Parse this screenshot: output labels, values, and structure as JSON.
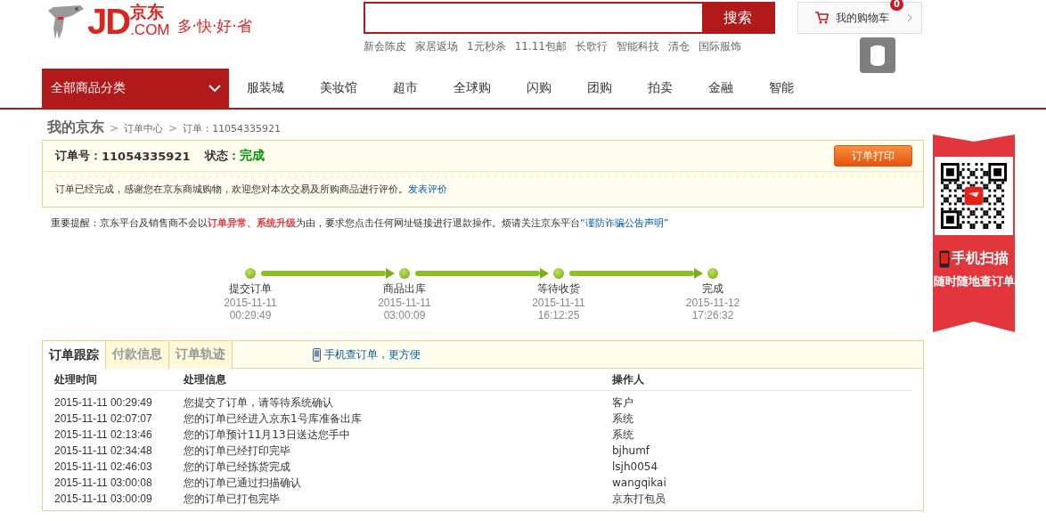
{
  "logo": {
    "mark": "JD",
    "domain": ".COM",
    "name": "京东",
    "slogan": "多·快·好·省"
  },
  "search": {
    "button": "搜索"
  },
  "hot_links": [
    "新会陈皮",
    "家居返场",
    "1元秒杀",
    "11.11包邮",
    "长歌行",
    "智能科技",
    "清仓",
    "国际服饰"
  ],
  "cart": {
    "label": "我的购物车",
    "count": "0"
  },
  "nav": {
    "category": "全部商品分类",
    "items": [
      "服装城",
      "美妆馆",
      "超市",
      "全球购",
      "闪购",
      "团购",
      "拍卖",
      "金融",
      "智能"
    ]
  },
  "breadcrumb": {
    "home": "我的京东",
    "items": [
      {
        "separator": ">",
        "label": "订单中心"
      },
      {
        "separator": ">",
        "label": "订单：11054335921"
      }
    ]
  },
  "order": {
    "number_label": "订单号：",
    "number": "11054335921",
    "status_label": "状态：",
    "status": "完成",
    "print_button": "订单打印",
    "message": "订单已经完成，感谢您在京东商城购物，欢迎您对本次交易及所购商品进行评价。",
    "review_link": "发表评价"
  },
  "reminder": {
    "text": "重要提醒：京东平台及销售商不会以**订单异常、系统升级**为由，要求您点击任何网址链接进行退款操作。烦请关注京东平台",
    "link": "“谨防诈骗公告声明”"
  },
  "progress": [
    {
      "label": "提交订单",
      "date": "2015-11-11",
      "time": "00:29:49",
      "done": true
    },
    {
      "label": "商品出库",
      "date": "2015-11-11",
      "time": "03:00:09",
      "done": true
    },
    {
      "label": "等待收货",
      "date": "2015-11-11",
      "time": "16:12:25",
      "done": true
    },
    {
      "label": "完成",
      "date": "2015-11-12",
      "time": "17:26:32",
      "done": true
    }
  ],
  "tabs": [
    {
      "label": "订单跟踪",
      "selected": true
    },
    {
      "label": "付款信息",
      "selected": false
    },
    {
      "label": "订单轨迹",
      "selected": false
    }
  ],
  "mobile_link": "手机查订单，更方便",
  "table": {
    "columns": [
      "处理时间",
      "处理信息",
      "操作人"
    ],
    "rows": [
      [
        "2015-11-11 00:29:49",
        "您提交了订单，请等待系统确认",
        "客户"
      ],
      [
        "2015-11-11 02:07:07",
        "您的订单已经进入京东1号库准备出库",
        "系统"
      ],
      [
        "2015-11-11 02:13:46",
        "您的订单预计11月13日送达您手中",
        "系统"
      ],
      [
        "2015-11-11 02:34:48",
        "您的订单已经打印完毕",
        "bjhumf"
      ],
      [
        "2015-11-11 02:46:03",
        "您的订单已经拣货完成",
        "lsjh0054"
      ],
      [
        "2015-11-11 03:00:08",
        "您的订单已通过扫描确认",
        "wangqikai"
      ],
      [
        "2015-11-11 03:00:09",
        "您的订单已打包完毕",
        "京东打包员"
      ]
    ]
  },
  "qr_banner": {
    "title": "手机扫描",
    "subtitle": "随时随地查订单"
  }
}
